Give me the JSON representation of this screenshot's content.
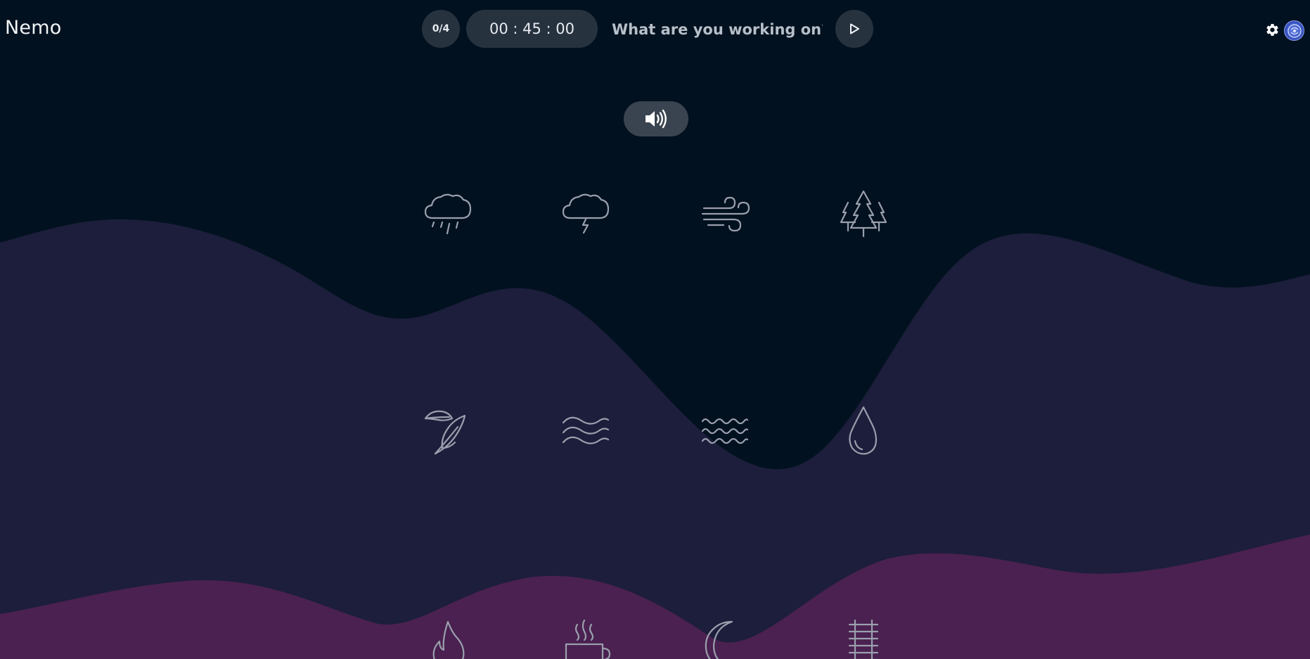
{
  "app": {
    "title": "Nemo"
  },
  "header": {
    "session_count": "0/4",
    "timer": "00 : 45 : 00",
    "task_placeholder": "What are you working on?",
    "play_icon": "play-icon",
    "settings_icon": "gear-icon",
    "avatar_icon": "avatar-icon"
  },
  "volume": {
    "icon": "volume-up-icon"
  },
  "sounds": [
    {
      "icon": "rain-cloud-icon"
    },
    {
      "icon": "thunder-cloud-icon"
    },
    {
      "icon": "wind-icon"
    },
    {
      "icon": "forest-icon"
    },
    {
      "icon": "leaf-icon"
    },
    {
      "icon": "waves-icon"
    },
    {
      "icon": "ocean-icon"
    },
    {
      "icon": "water-drop-icon"
    },
    {
      "icon": "fire-icon"
    },
    {
      "icon": "coffee-cup-icon"
    },
    {
      "icon": "moon-icon"
    },
    {
      "icon": "train-tracks-icon"
    }
  ],
  "colors": {
    "background": "#02111f",
    "wave_navy": "#1c1e3b",
    "wave_purple": "#4a2150",
    "button_bg": "#27323f",
    "icon_stroke": "#9a9fad"
  }
}
